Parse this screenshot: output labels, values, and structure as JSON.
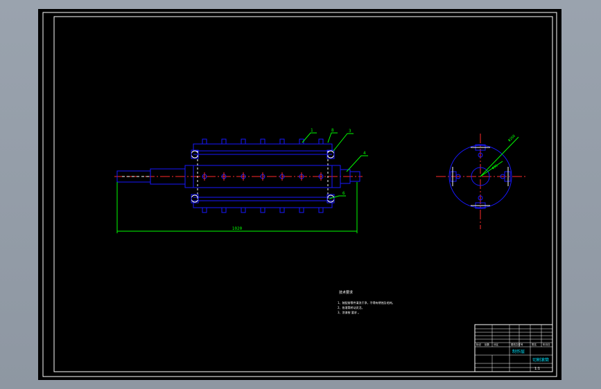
{
  "drawing": {
    "callouts": [
      "1",
      "8",
      "3",
      "4",
      "6"
    ],
    "overall_dimension": "1020",
    "diameter_outer": "Φ260",
    "diameter_inner": "Φ96",
    "tech_req_title": "技术要求",
    "tech_req_lines": [
      "1、装配前零件清洗干净，不得有锈蚀及毛刺。",
      "2、各滚筒转动灵活。",
      "3、涂漆按 要求 。"
    ],
    "title_block": {
      "drawing_name": "切割滚筒",
      "designer_label": "制作层",
      "scale": "1:1",
      "header_cells": [
        "标记",
        "处数",
        "分区",
        "更改文件号",
        "签名",
        "年月日"
      ]
    }
  },
  "colors": {
    "background": "#000000",
    "part_outline": "#1818ff",
    "dimension": "#00ff00",
    "frame": "#ffffff",
    "centerline": "#ff2a2a",
    "hidden": "#ffffff",
    "title_text": "#00e5ff"
  }
}
